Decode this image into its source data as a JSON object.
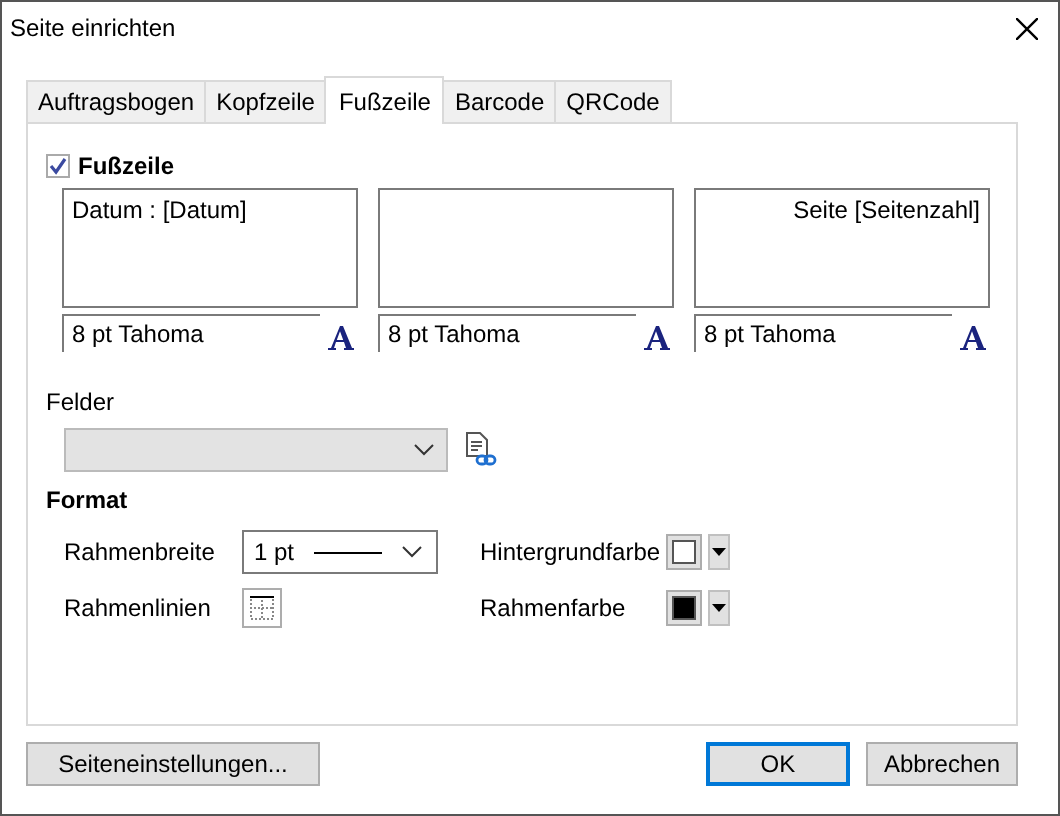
{
  "window": {
    "title": "Seite einrichten"
  },
  "tabs": [
    {
      "label": "Auftragsbogen",
      "selected": false
    },
    {
      "label": "Kopfzeile",
      "selected": false
    },
    {
      "label": "Fußzeile",
      "selected": true
    },
    {
      "label": "Barcode",
      "selected": false
    },
    {
      "label": "QRCode",
      "selected": false
    }
  ],
  "footer": {
    "label": "Fußzeile",
    "checked": true,
    "sections": [
      {
        "text": "Datum : [Datum]",
        "font": "8 pt Tahoma"
      },
      {
        "font": "8 pt Tahoma"
      },
      {
        "text": "Seite [Seitenzahl]",
        "font": "8 pt Tahoma"
      }
    ]
  },
  "fields": {
    "label": "Felder",
    "disabled": true
  },
  "format": {
    "heading": "Format",
    "border_width": {
      "label": "Rahmenbreite",
      "value": "1 pt"
    },
    "border_lines": {
      "label": "Rahmenlinien"
    },
    "background_color": {
      "label": "Hintergrundfarbe",
      "color": "#ffffff"
    },
    "border_color": {
      "label": "Rahmenfarbe",
      "color": "#000000"
    }
  },
  "buttons": [
    {
      "label": "Seiteneinstellungen...",
      "kind": "secondary"
    },
    {
      "label": "OK",
      "kind": "default"
    },
    {
      "label": "Abbrechen",
      "kind": "secondary"
    }
  ]
}
